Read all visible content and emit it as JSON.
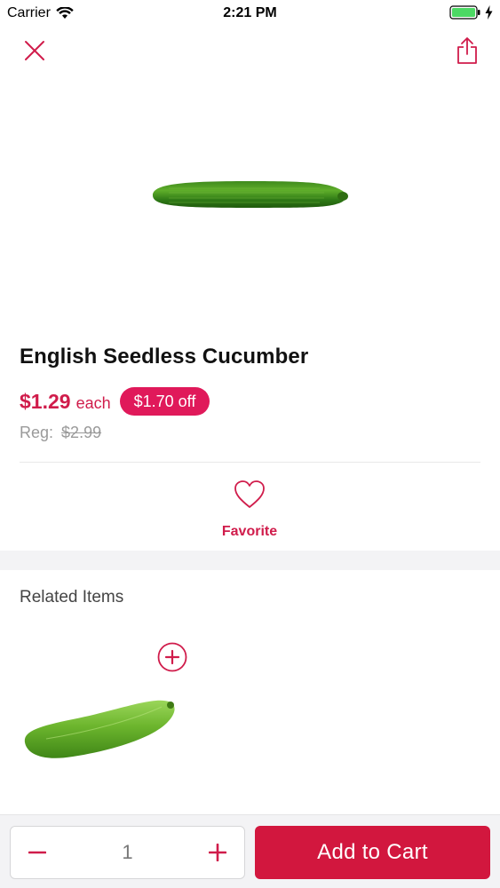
{
  "status_bar": {
    "carrier": "Carrier",
    "time": "2:21 PM",
    "battery_color": "#4cd964"
  },
  "nav": {
    "close_icon": "close-icon",
    "share_icon": "share-icon"
  },
  "product": {
    "title": "English Seedless Cucumber",
    "price": "$1.29",
    "unit": "each",
    "discount": "$1.70 off",
    "reg_label": "Reg:",
    "reg_price": "$2.99"
  },
  "favorite": {
    "label": "Favorite",
    "icon": "heart-icon"
  },
  "related": {
    "title": "Related Items",
    "add_icon": "plus-circle-icon"
  },
  "cart": {
    "quantity": "1",
    "add_label": "Add to Cart"
  },
  "colors": {
    "accent": "#d01c4b",
    "badge": "#e0195a",
    "cart_button": "#d2173e"
  }
}
